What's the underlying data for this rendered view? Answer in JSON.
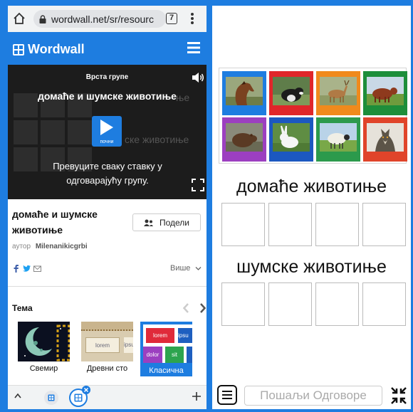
{
  "browser": {
    "url": "wordwall.net/sr/resourc",
    "tab_count": "7"
  },
  "site": {
    "logo_text": "Wordwall",
    "brand_color": "#1e7de0"
  },
  "player": {
    "group_type_label": "Врста групе",
    "title": "домаће и шумске животиње",
    "start_label": "почни",
    "instruction": "Превуците сваку ставку у одговарајућу групу.",
    "ghost_text_1": "ње",
    "ghost_text_2": "ске животиње"
  },
  "activity": {
    "title": "домаће и шумске животиње",
    "share_label": "Подели",
    "author_prefix": "аутор",
    "author_name": "Milenanikicgrbi",
    "more_label": "Више"
  },
  "theme": {
    "heading": "Тема",
    "cards": [
      {
        "label": "Свемир",
        "selected": false
      },
      {
        "label": "Древни сто",
        "selected": false
      },
      {
        "label": "Класична",
        "selected": true
      }
    ],
    "card2_text_1": "lorem",
    "card2_text_2": "ipsu",
    "card3_text_1": "lorem",
    "card3_text_2": "ipsu",
    "card3_text_3": "dolor",
    "card3_text_4": "sit"
  },
  "game": {
    "tiles": [
      {
        "animal": "horse",
        "color": "#1e7de0"
      },
      {
        "animal": "dog",
        "color": "#e0262a"
      },
      {
        "animal": "deer",
        "color": "#f08a1c"
      },
      {
        "animal": "cow",
        "color": "#1d8e3a"
      },
      {
        "animal": "bear",
        "color": "#9c3fc0"
      },
      {
        "animal": "rabbit",
        "color": "#1c58c0"
      },
      {
        "animal": "sheep",
        "color": "#2c9a4c"
      },
      {
        "animal": "wolf",
        "color": "#e0442a"
      }
    ],
    "group_1": "домаће животиње",
    "group_2": "шумске животиње",
    "submit_label": "Пошаљи Одговоре"
  }
}
